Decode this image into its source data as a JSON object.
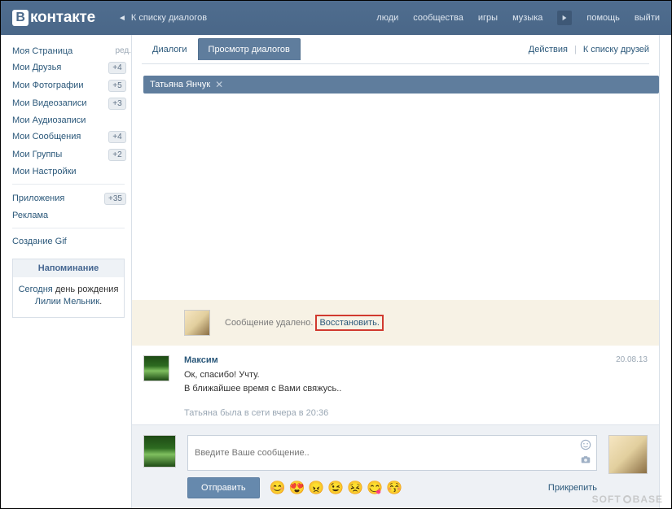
{
  "header": {
    "logo": "контакте",
    "logo_letter": "В",
    "back": "К списку диалогов",
    "nav": {
      "people": "люди",
      "communities": "сообщества",
      "games": "игры",
      "music": "музыка",
      "help": "помощь",
      "logout": "выйти"
    }
  },
  "sidebar": {
    "items": [
      {
        "label": "Моя Страница",
        "badge": null,
        "edit": "ред."
      },
      {
        "label": "Мои Друзья",
        "badge": "+4"
      },
      {
        "label": "Мои Фотографии",
        "badge": "+5"
      },
      {
        "label": "Мои Видеозаписи",
        "badge": "+3"
      },
      {
        "label": "Мои Аудиозаписи",
        "badge": null
      },
      {
        "label": "Мои Сообщения",
        "badge": "+4"
      },
      {
        "label": "Мои Группы",
        "badge": "+2"
      },
      {
        "label": "Мои Настройки",
        "badge": null
      }
    ],
    "group2": [
      {
        "label": "Приложения",
        "badge": "+35"
      },
      {
        "label": "Реклама",
        "badge": null
      }
    ],
    "group3": [
      {
        "label": "Создание Gif",
        "badge": null
      }
    ],
    "reminder": {
      "title": "Напоминание",
      "today": "Сегодня",
      "text": " день рождения ",
      "link": "Лилии Мельник"
    }
  },
  "tabs": {
    "dialogs": "Диалоги",
    "view": "Просмотр диалогов",
    "actions": "Действия",
    "friends": "К списку друзей"
  },
  "conversation": {
    "contact_name": "Татьяна Янчук",
    "deleted": {
      "text": "Сообщение удалено.",
      "restore": "Восстановить."
    },
    "message": {
      "author": "Максим",
      "date": "20.08.13",
      "line1": "Ок, спасибо! Учту.",
      "line2": "В ближайшее время с Вами свяжусь.."
    },
    "last_seen": "Татьяна была в сети вчера в 20:36"
  },
  "compose": {
    "placeholder": "Введите Ваше сообщение..",
    "send": "Отправить",
    "attach": "Прикрепить",
    "emojis": [
      "😊",
      "😍",
      "😠",
      "😉",
      "😣",
      "😋",
      "😚"
    ]
  },
  "watermark": {
    "left": "SOFT",
    "right": "BASE"
  }
}
